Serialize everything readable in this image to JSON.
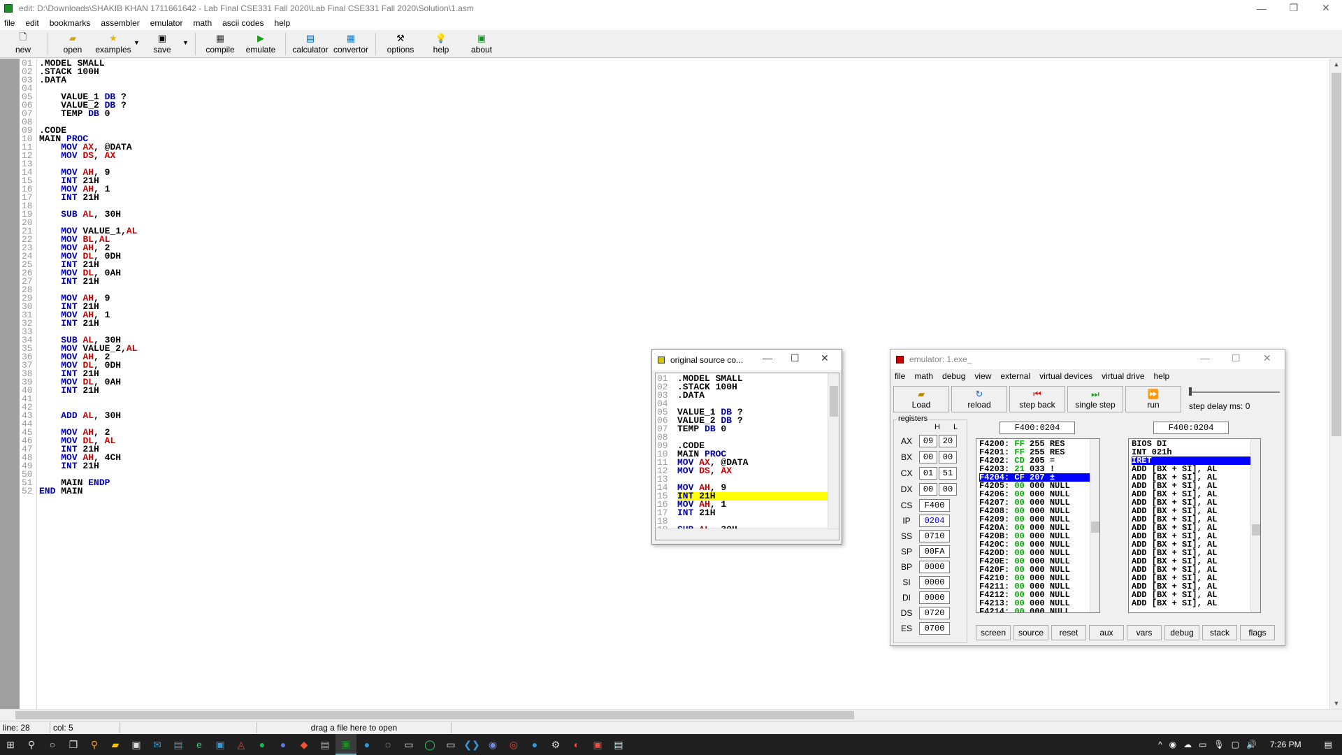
{
  "window": {
    "title": "edit: D:\\Downloads\\SHAKIB KHAN 1711661642 - Lab Final CSE331 Fall 2020\\Lab Final CSE331 Fall 2020\\Solution\\1.asm",
    "minimize": "—",
    "maximize": "❐",
    "close": "✕"
  },
  "menu": [
    "file",
    "edit",
    "bookmarks",
    "assembler",
    "emulator",
    "math",
    "ascii codes",
    "help"
  ],
  "toolbar": {
    "new": "new",
    "open": "open",
    "examples": "examples",
    "save": "save",
    "compile": "compile",
    "emulate": "emulate",
    "calculator": "calculator",
    "convertor": "convertor",
    "options": "options",
    "help": "help",
    "about": "about"
  },
  "status": {
    "line": "line: 28",
    "col": "col: 5",
    "hint": "drag a file here to open"
  },
  "source_window": {
    "title": "original source co...",
    "minimize": "—",
    "maximize": "☐",
    "close": "✕"
  },
  "emulator": {
    "title": "emulator: 1.exe_",
    "minimize": "—",
    "maximize": "☐",
    "close": "✕",
    "menu": [
      "file",
      "math",
      "debug",
      "view",
      "external",
      "virtual devices",
      "virtual drive",
      "help"
    ],
    "buttons": {
      "load": "Load",
      "reload": "reload",
      "step_back": "step back",
      "single_step": "single step",
      "run": "run"
    },
    "step_delay": "step delay ms: 0",
    "registers_label": "registers",
    "col_h": "H",
    "col_l": "L",
    "regs8": [
      {
        "name": "AX",
        "h": "09",
        "l": "20"
      },
      {
        "name": "BX",
        "h": "00",
        "l": "00"
      },
      {
        "name": "CX",
        "h": "01",
        "l": "51"
      },
      {
        "name": "DX",
        "h": "00",
        "l": "00"
      }
    ],
    "regs16": [
      {
        "name": "CS",
        "v": "F400"
      },
      {
        "name": "IP",
        "v": "0204"
      },
      {
        "name": "SS",
        "v": "0710"
      },
      {
        "name": "SP",
        "v": "00FA"
      },
      {
        "name": "BP",
        "v": "0000"
      },
      {
        "name": "SI",
        "v": "0000"
      },
      {
        "name": "DI",
        "v": "0000"
      },
      {
        "name": "DS",
        "v": "0720"
      },
      {
        "name": "ES",
        "v": "0700"
      }
    ],
    "addr_left": "F400:0204",
    "addr_right": "F400:0204",
    "bottom_buttons": [
      "screen",
      "source",
      "reset",
      "aux",
      "vars",
      "debug",
      "stack",
      "flags"
    ]
  },
  "taskbar": {
    "time": "7:26 PM"
  }
}
